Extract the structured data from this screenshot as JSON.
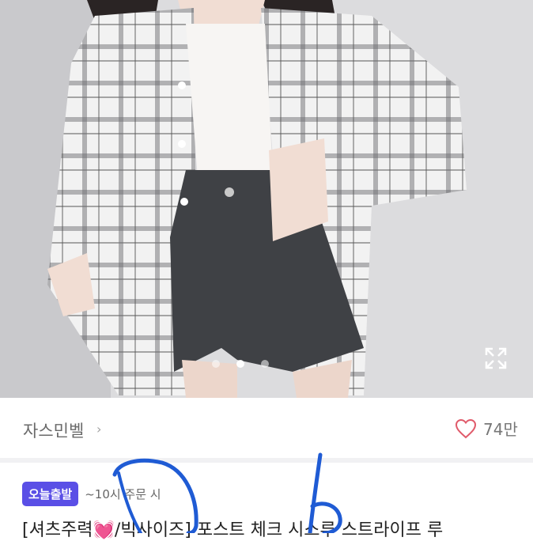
{
  "product": {
    "image_alt": "Product photo",
    "carousel": {
      "total": 3,
      "active": 2
    },
    "expand_icon": "expand-icon"
  },
  "shop": {
    "name": "자스민벨",
    "chevron": "›",
    "like_icon": "heart-outline-icon",
    "like_count": "74만"
  },
  "delivery": {
    "badge": "오늘출발",
    "note": "~10시 주문 시"
  },
  "title": "[셔츠주력💓/빅사이즈] 포스트 체크 시스루 스트라이프 루",
  "colors": {
    "badge": "#5a4fe6",
    "heart": "#e05a6a",
    "annotation_pen": "#1f5bd4"
  }
}
